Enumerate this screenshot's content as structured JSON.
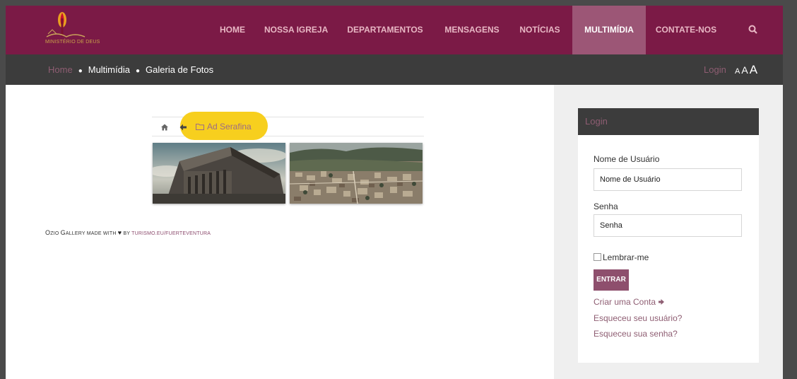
{
  "logo": {
    "text": "MINISTÉRIO DE DEUS",
    "icon": "flame-logo-icon"
  },
  "nav": {
    "items": [
      {
        "label": "HOME"
      },
      {
        "label": "NOSSA IGREJA"
      },
      {
        "label": "DEPARTAMENTOS"
      },
      {
        "label": "MENSAGENS"
      },
      {
        "label": "NOTÍCIAS"
      },
      {
        "label": "MULTIMÍDIA",
        "active": true
      },
      {
        "label": "CONTATE-NOS"
      }
    ],
    "search_icon": "search-icon"
  },
  "breadcrumb": {
    "home": "Home",
    "items": [
      "Multimídia",
      "Galeria de Fotos"
    ]
  },
  "topright": {
    "login": "Login",
    "font_sizes": [
      "A",
      "A",
      "A"
    ]
  },
  "gallery": {
    "folder": "Ad Serafina",
    "icons": [
      "home-icon",
      "back-arrow-icon",
      "folder-icon"
    ]
  },
  "credit": {
    "o": "O",
    "zio": "ZIO ",
    "g": "G",
    "allery": "ALLERY MADE WITH ",
    "heart": "♥",
    "by": " BY ",
    "link": "TURISMO.EU/FUERTEVENTURA"
  },
  "login": {
    "title": "Login",
    "username_label": "Nome de Usuário",
    "username_placeholder": "Nome de Usuário",
    "password_label": "Senha",
    "password_placeholder": "Senha",
    "remember": "Lembrar-me",
    "submit": "ENTRAR",
    "create_account": "Criar uma Conta",
    "forgot_user": "Esqueceu seu usuário?",
    "forgot_password": "Esqueceu sua senha?"
  },
  "colors": {
    "brand": "#7b1a46",
    "nav_active": "#9c5676",
    "link": "#8e5d72",
    "highlight": "#f7cf1e",
    "dark_bar": "#3c3c3c"
  }
}
